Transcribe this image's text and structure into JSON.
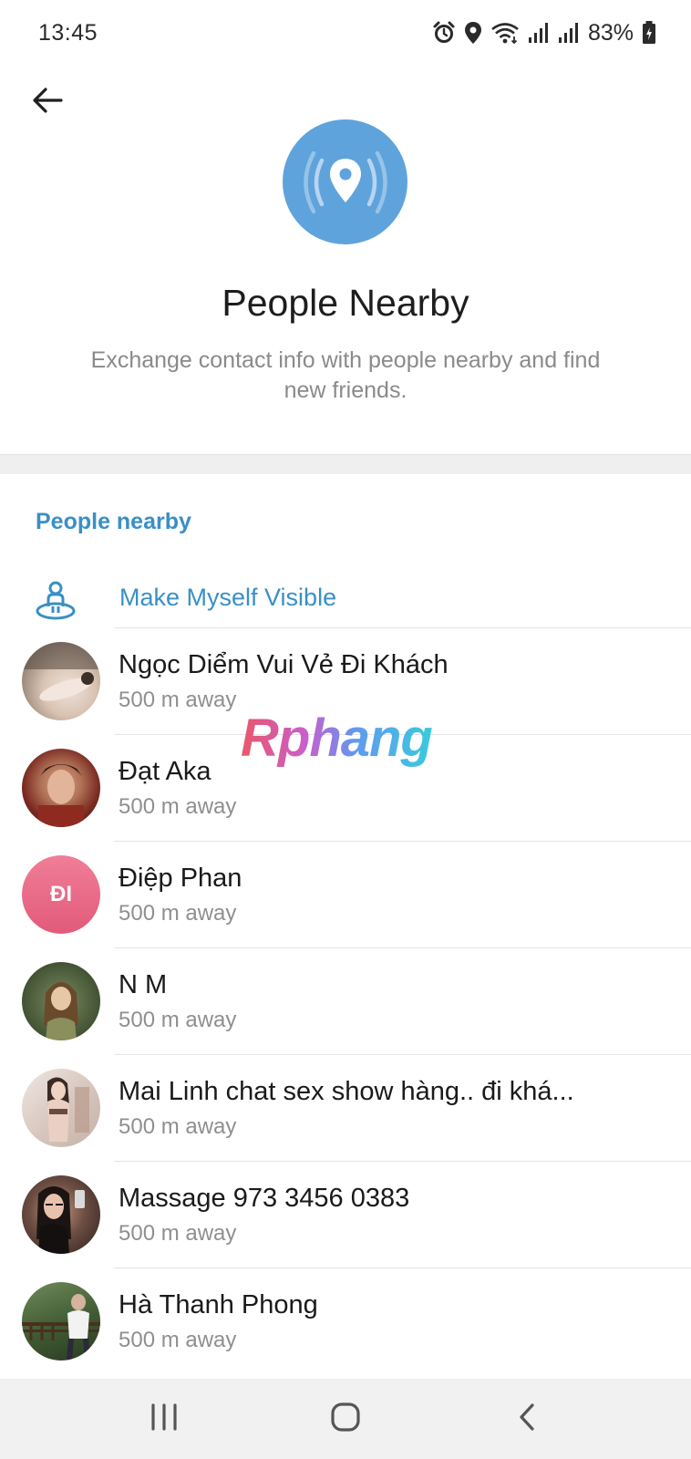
{
  "status_bar": {
    "time": "13:45",
    "battery": "83%",
    "icons": [
      "alarm-icon",
      "location-icon",
      "wifi-icon",
      "signal-icon",
      "signal-icon",
      "battery-charging-icon"
    ]
  },
  "header": {
    "back_icon": "arrow-left-icon",
    "hero_icon": "location-radar-icon",
    "title": "People Nearby",
    "description": "Exchange contact info with people nearby and find new friends."
  },
  "section": {
    "header": "People nearby",
    "visible_action": {
      "icon": "person-radar-icon",
      "label": "Make Myself Visible"
    }
  },
  "people": [
    {
      "name": "Ngọc Diểm Vui Vẻ Đi Khách",
      "distance": "500 m away",
      "avatar": "photo"
    },
    {
      "name": "Đạt Aka",
      "distance": "500 m away",
      "avatar": "photo"
    },
    {
      "name": "Điệp Phan",
      "distance": "500 m away",
      "avatar": "initials",
      "initials": "ĐI"
    },
    {
      "name": "N M",
      "distance": "500 m away",
      "avatar": "photo"
    },
    {
      "name": "Mai Linh chat sex show hàng.. đi khá...",
      "distance": "500 m away",
      "avatar": "photo"
    },
    {
      "name": "Massage 973 3456 0383",
      "distance": "500 m away",
      "avatar": "photo"
    },
    {
      "name": "Hà Thanh Phong",
      "distance": "500 m away",
      "avatar": "photo"
    }
  ],
  "watermark": "Rphang",
  "nav_bar": {
    "recents_icon": "recents-icon",
    "home_icon": "home-icon",
    "back_icon": "back-chevron-icon"
  },
  "colors": {
    "accent": "#3a8fc6",
    "hero_circle": "#5fa3dc",
    "initials_avatar": "#e8607f"
  }
}
